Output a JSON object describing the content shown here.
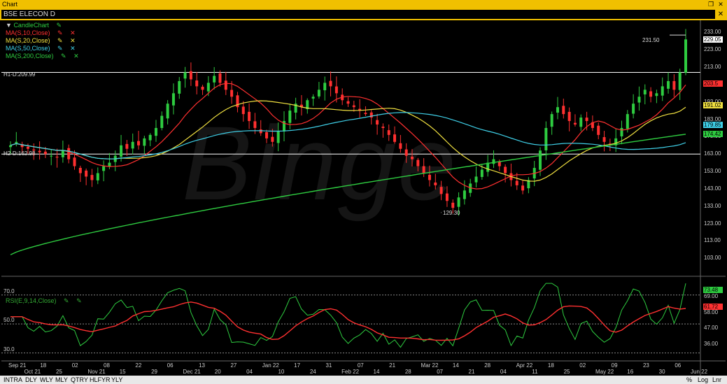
{
  "window": {
    "title": "Chart",
    "symbol": "BSE ELECON D",
    "restore_glyph": "❐",
    "close_glyph": "✕"
  },
  "legend": [
    {
      "label": "CandleChart",
      "color": "#2ecc40",
      "triangle": "▼"
    },
    {
      "label": "MA(S,10,Close)",
      "color": "#ff3030"
    },
    {
      "label": "MA(S,20,Close)",
      "color": "#f0e040"
    },
    {
      "label": "MA(S,50,Close)",
      "color": "#3fd0e8"
    },
    {
      "label": "MA(S,200,Close)",
      "color": "#2ecc40"
    }
  ],
  "rsi_legend": {
    "label": "RSI(E,9,14,Close)",
    "color": "#2ecc40"
  },
  "hlines": [
    {
      "label": "H1-D:209.99",
      "value": 209.99
    },
    {
      "label": "H2-D:162.98",
      "value": 162.98
    }
  ],
  "annotations": {
    "high": "231.50",
    "low": "129.30"
  },
  "price_axis": [
    "233.00",
    "223.00",
    "213.00",
    "203.00",
    "193.00",
    "183.00",
    "173.00",
    "163.00",
    "153.00",
    "143.00",
    "133.00",
    "123.00",
    "113.00",
    "103.00"
  ],
  "price_badges": [
    {
      "text": "229.05",
      "bg": "#ffffff",
      "fg": "#000000",
      "value": 229.05
    },
    {
      "text": "203.5",
      "bg": "#ff3030",
      "fg": "#000000",
      "value": 203.5
    },
    {
      "text": "191.02",
      "bg": "#f0e040",
      "fg": "#000000",
      "value": 191.02
    },
    {
      "text": "179.85",
      "bg": "#3fd0e8",
      "fg": "#000000",
      "value": 179.85
    },
    {
      "text": "174.42",
      "bg": "#2ecc40",
      "fg": "#000000",
      "value": 174.42
    }
  ],
  "rsi_axis": [
    "69.00",
    "58.00",
    "47.00",
    "36.00"
  ],
  "rsi_levels": [
    "70.0",
    "50.0",
    "30.0"
  ],
  "rsi_badges": [
    {
      "text": "73.48",
      "bg": "#2ecc40",
      "value": 73.48
    },
    {
      "text": "61.72",
      "bg": "#ff3030",
      "value": 61.72
    }
  ],
  "x_axis": [
    {
      "label": "Sep 21"
    },
    {
      "label": "Oct 21"
    },
    {
      "label": "18"
    },
    {
      "label": "25"
    },
    {
      "label": "02"
    },
    {
      "label": "Nov 21"
    },
    {
      "label": "08"
    },
    {
      "label": "15"
    },
    {
      "label": "22"
    },
    {
      "label": "29"
    },
    {
      "label": "06"
    },
    {
      "label": "Dec 21"
    },
    {
      "label": "13"
    },
    {
      "label": "20"
    },
    {
      "label": "27"
    },
    {
      "label": "04"
    },
    {
      "label": "Jan 22"
    },
    {
      "label": "10"
    },
    {
      "label": "17"
    },
    {
      "label": "24"
    },
    {
      "label": "31"
    },
    {
      "label": "Feb 22"
    },
    {
      "label": "07"
    },
    {
      "label": "14"
    },
    {
      "label": "21"
    },
    {
      "label": "28"
    },
    {
      "label": "Mar 22"
    },
    {
      "label": "07"
    },
    {
      "label": "14"
    },
    {
      "label": "21"
    },
    {
      "label": "28"
    },
    {
      "label": "04"
    },
    {
      "label": "Apr 22"
    },
    {
      "label": "11"
    },
    {
      "label": "18"
    },
    {
      "label": "25"
    },
    {
      "label": "02"
    },
    {
      "label": "May 22"
    },
    {
      "label": "09"
    },
    {
      "label": "16"
    },
    {
      "label": "23"
    },
    {
      "label": "30"
    },
    {
      "label": "06"
    },
    {
      "label": "Jun 22"
    }
  ],
  "bottom_tabs": [
    "INTRA",
    "DLY",
    "WLY",
    "MLY",
    "QTRY",
    "HLFYR",
    "YLY"
  ],
  "bottom_right": [
    "%",
    "Log",
    "Lnr"
  ],
  "watermark": "Binge",
  "chart_data": {
    "type": "candlestick",
    "price_range": [
      93,
      238
    ],
    "rsi_range": [
      25,
      80
    ],
    "closes": [
      168,
      170,
      167,
      166,
      165,
      164,
      163,
      162,
      161,
      165,
      160,
      156,
      152,
      150,
      148,
      152,
      156,
      158,
      162,
      168,
      166,
      170,
      168,
      172,
      174,
      178,
      185,
      192,
      198,
      205,
      210,
      206,
      202,
      200,
      204,
      208,
      204,
      200,
      196,
      190,
      186,
      182,
      178,
      175,
      172,
      170,
      176,
      182,
      188,
      192,
      190,
      194,
      196,
      200,
      204,
      202,
      198,
      194,
      192,
      190,
      188,
      186,
      184,
      180,
      178,
      174,
      170,
      166,
      162,
      160,
      156,
      152,
      148,
      145,
      140,
      136,
      132,
      138,
      142,
      146,
      150,
      154,
      158,
      160,
      156,
      152,
      148,
      145,
      142,
      148,
      155,
      165,
      178,
      186,
      190,
      186,
      182,
      180,
      184,
      182,
      178,
      174,
      170,
      168,
      172,
      178,
      186,
      192,
      196,
      200,
      196,
      198,
      202,
      205,
      200,
      210,
      229
    ]
  }
}
